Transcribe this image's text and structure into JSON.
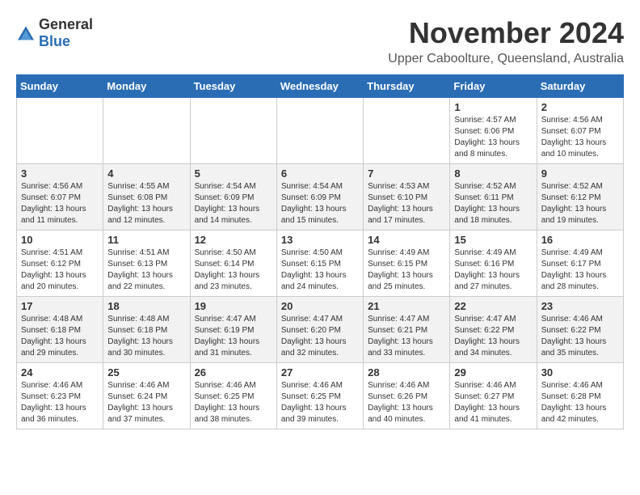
{
  "header": {
    "logo_general": "General",
    "logo_blue": "Blue",
    "month": "November 2024",
    "location": "Upper Caboolture, Queensland, Australia"
  },
  "weekdays": [
    "Sunday",
    "Monday",
    "Tuesday",
    "Wednesday",
    "Thursday",
    "Friday",
    "Saturday"
  ],
  "weeks": [
    [
      {
        "day": "",
        "info": ""
      },
      {
        "day": "",
        "info": ""
      },
      {
        "day": "",
        "info": ""
      },
      {
        "day": "",
        "info": ""
      },
      {
        "day": "",
        "info": ""
      },
      {
        "day": "1",
        "info": "Sunrise: 4:57 AM\nSunset: 6:06 PM\nDaylight: 13 hours\nand 8 minutes."
      },
      {
        "day": "2",
        "info": "Sunrise: 4:56 AM\nSunset: 6:07 PM\nDaylight: 13 hours\nand 10 minutes."
      }
    ],
    [
      {
        "day": "3",
        "info": "Sunrise: 4:56 AM\nSunset: 6:07 PM\nDaylight: 13 hours\nand 11 minutes."
      },
      {
        "day": "4",
        "info": "Sunrise: 4:55 AM\nSunset: 6:08 PM\nDaylight: 13 hours\nand 12 minutes."
      },
      {
        "day": "5",
        "info": "Sunrise: 4:54 AM\nSunset: 6:09 PM\nDaylight: 13 hours\nand 14 minutes."
      },
      {
        "day": "6",
        "info": "Sunrise: 4:54 AM\nSunset: 6:09 PM\nDaylight: 13 hours\nand 15 minutes."
      },
      {
        "day": "7",
        "info": "Sunrise: 4:53 AM\nSunset: 6:10 PM\nDaylight: 13 hours\nand 17 minutes."
      },
      {
        "day": "8",
        "info": "Sunrise: 4:52 AM\nSunset: 6:11 PM\nDaylight: 13 hours\nand 18 minutes."
      },
      {
        "day": "9",
        "info": "Sunrise: 4:52 AM\nSunset: 6:12 PM\nDaylight: 13 hours\nand 19 minutes."
      }
    ],
    [
      {
        "day": "10",
        "info": "Sunrise: 4:51 AM\nSunset: 6:12 PM\nDaylight: 13 hours\nand 20 minutes."
      },
      {
        "day": "11",
        "info": "Sunrise: 4:51 AM\nSunset: 6:13 PM\nDaylight: 13 hours\nand 22 minutes."
      },
      {
        "day": "12",
        "info": "Sunrise: 4:50 AM\nSunset: 6:14 PM\nDaylight: 13 hours\nand 23 minutes."
      },
      {
        "day": "13",
        "info": "Sunrise: 4:50 AM\nSunset: 6:15 PM\nDaylight: 13 hours\nand 24 minutes."
      },
      {
        "day": "14",
        "info": "Sunrise: 4:49 AM\nSunset: 6:15 PM\nDaylight: 13 hours\nand 25 minutes."
      },
      {
        "day": "15",
        "info": "Sunrise: 4:49 AM\nSunset: 6:16 PM\nDaylight: 13 hours\nand 27 minutes."
      },
      {
        "day": "16",
        "info": "Sunrise: 4:49 AM\nSunset: 6:17 PM\nDaylight: 13 hours\nand 28 minutes."
      }
    ],
    [
      {
        "day": "17",
        "info": "Sunrise: 4:48 AM\nSunset: 6:18 PM\nDaylight: 13 hours\nand 29 minutes."
      },
      {
        "day": "18",
        "info": "Sunrise: 4:48 AM\nSunset: 6:18 PM\nDaylight: 13 hours\nand 30 minutes."
      },
      {
        "day": "19",
        "info": "Sunrise: 4:47 AM\nSunset: 6:19 PM\nDaylight: 13 hours\nand 31 minutes."
      },
      {
        "day": "20",
        "info": "Sunrise: 4:47 AM\nSunset: 6:20 PM\nDaylight: 13 hours\nand 32 minutes."
      },
      {
        "day": "21",
        "info": "Sunrise: 4:47 AM\nSunset: 6:21 PM\nDaylight: 13 hours\nand 33 minutes."
      },
      {
        "day": "22",
        "info": "Sunrise: 4:47 AM\nSunset: 6:22 PM\nDaylight: 13 hours\nand 34 minutes."
      },
      {
        "day": "23",
        "info": "Sunrise: 4:46 AM\nSunset: 6:22 PM\nDaylight: 13 hours\nand 35 minutes."
      }
    ],
    [
      {
        "day": "24",
        "info": "Sunrise: 4:46 AM\nSunset: 6:23 PM\nDaylight: 13 hours\nand 36 minutes."
      },
      {
        "day": "25",
        "info": "Sunrise: 4:46 AM\nSunset: 6:24 PM\nDaylight: 13 hours\nand 37 minutes."
      },
      {
        "day": "26",
        "info": "Sunrise: 4:46 AM\nSunset: 6:25 PM\nDaylight: 13 hours\nand 38 minutes."
      },
      {
        "day": "27",
        "info": "Sunrise: 4:46 AM\nSunset: 6:25 PM\nDaylight: 13 hours\nand 39 minutes."
      },
      {
        "day": "28",
        "info": "Sunrise: 4:46 AM\nSunset: 6:26 PM\nDaylight: 13 hours\nand 40 minutes."
      },
      {
        "day": "29",
        "info": "Sunrise: 4:46 AM\nSunset: 6:27 PM\nDaylight: 13 hours\nand 41 minutes."
      },
      {
        "day": "30",
        "info": "Sunrise: 4:46 AM\nSunset: 6:28 PM\nDaylight: 13 hours\nand 42 minutes."
      }
    ]
  ]
}
